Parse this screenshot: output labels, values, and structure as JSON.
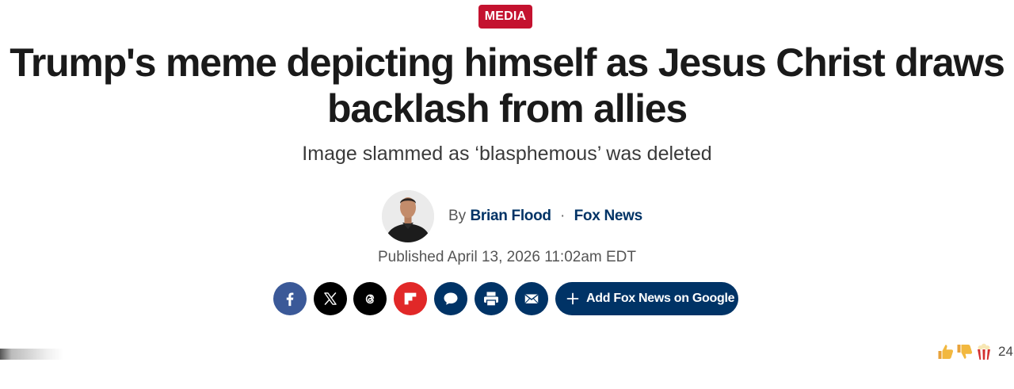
{
  "article": {
    "category": "MEDIA",
    "headline": "Trump's meme depicting himself as Jesus Christ draws backlash from allies",
    "subheadline": "Image slammed as ‘blasphemous’ was deleted",
    "byline": {
      "prefix": "By",
      "author": "Brian Flood",
      "separator": "·",
      "source": "Fox News"
    },
    "published": "Published April 13, 2026 11:02am EDT"
  },
  "share": {
    "buttons": [
      {
        "name": "facebook-share-button",
        "icon": "facebook-icon",
        "color": "#3b5998"
      },
      {
        "name": "x-share-button",
        "icon": "x-icon",
        "color": "#000000"
      },
      {
        "name": "threads-share-button",
        "icon": "threads-icon",
        "color": "#000000"
      },
      {
        "name": "flipboard-share-button",
        "icon": "flipboard-icon",
        "color": "#e12828"
      },
      {
        "name": "comments-button",
        "icon": "comment-icon",
        "color": "#003366"
      },
      {
        "name": "print-button",
        "icon": "print-icon",
        "color": "#003366"
      },
      {
        "name": "email-share-button",
        "icon": "email-icon",
        "color": "#003366"
      }
    ],
    "google_button_label": "Add Fox News on Google"
  },
  "reactions": {
    "icons": [
      "thumbs-up-icon",
      "thumbs-down-icon",
      "popcorn-icon"
    ],
    "count": "24"
  },
  "colors": {
    "brand_navy": "#003366",
    "category_red": "#c4122f",
    "headline_text": "#1a1a1a"
  }
}
